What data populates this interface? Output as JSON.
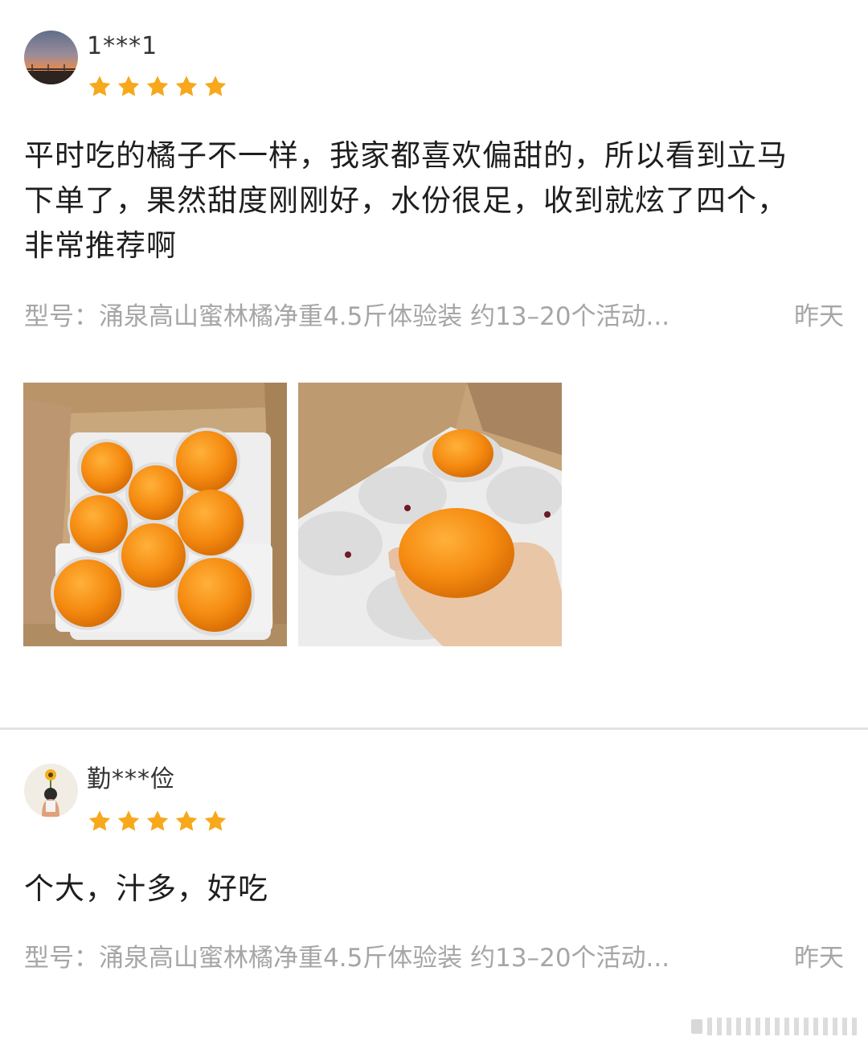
{
  "colors": {
    "star": "#f7a81b",
    "meta_text": "#a6a6a6",
    "orange": "#f08a12",
    "divider": "#e3e3e3"
  },
  "reviews": [
    {
      "username": "1***1",
      "avatar_icon": "sunset-avatar",
      "rating": 5,
      "content_lines": [
        "平时吃的橘子不一样，我家都喜欢偏甜的，所以看到立马",
        "下单了，果然甜度刚刚好，水份很足，收到就炫了四个，",
        "非常推荐啊"
      ],
      "spec": "型号：涌泉高山蜜林橘净重4.5斤体验装 约13–20个活动...",
      "time": "昨天",
      "photos": [
        "box-of-mandarins-photo",
        "hand-holding-mandarin-photo"
      ]
    },
    {
      "username": "勤***俭",
      "avatar_icon": "sunflower-girl-avatar",
      "rating": 5,
      "content_lines": [
        "个大，汁多，好吃"
      ],
      "spec": "型号：涌泉高山蜜林橘净重4.5斤体验装 约13–20个活动...",
      "time": "昨天"
    }
  ]
}
